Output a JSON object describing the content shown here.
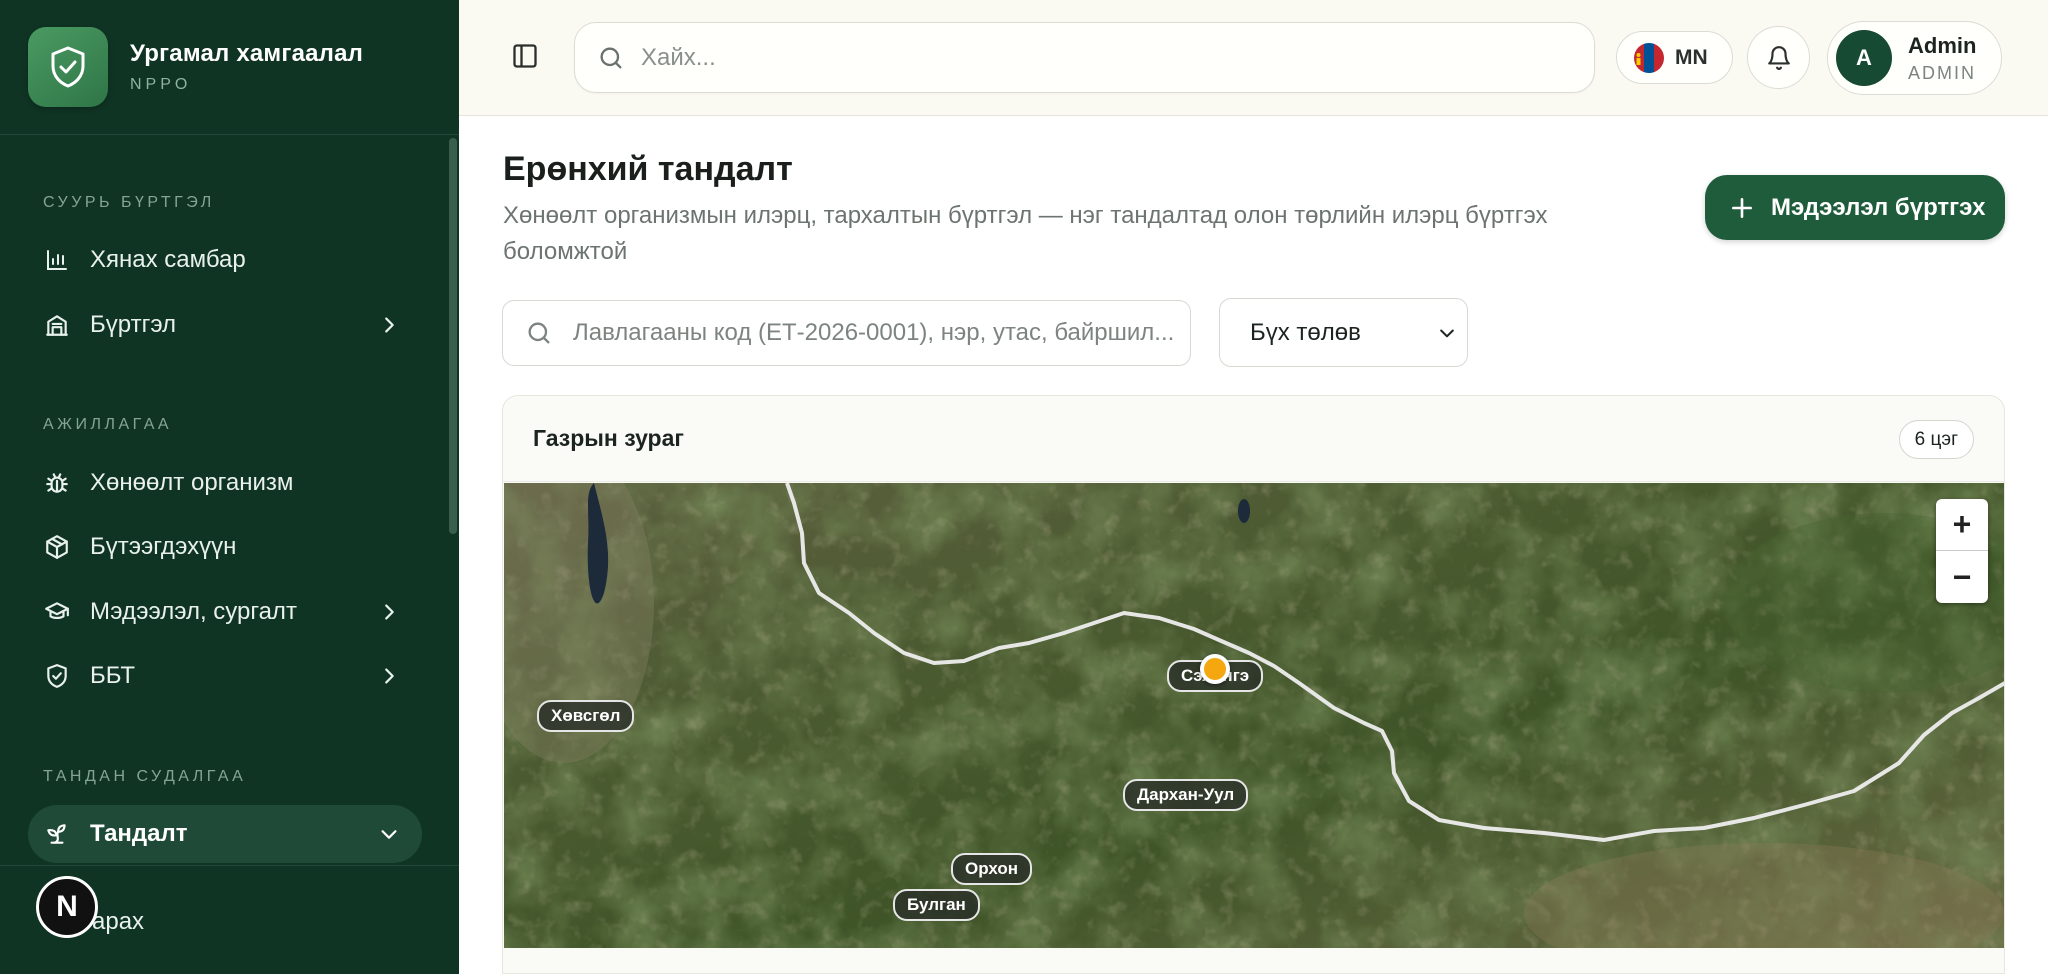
{
  "app": {
    "title": "Ургамал хамгаалал",
    "subtitle": "NPPO"
  },
  "sidebar": {
    "sections": [
      {
        "title": "СУУРЬ БҮРТГЭЛ"
      },
      {
        "title": "АЖИЛЛАГАА"
      },
      {
        "title": "ТАНДАН СУДАЛГАА"
      }
    ],
    "items": [
      {
        "label": "Хянах самбар",
        "icon": "bar-chart-icon"
      },
      {
        "label": "Бүртгэл",
        "icon": "building-icon"
      },
      {
        "label": "Хөнөөлт организм",
        "icon": "bug-icon"
      },
      {
        "label": "Бүтээгдэхүүн",
        "icon": "box-icon"
      },
      {
        "label": "Мэдээлэл, сургалт",
        "icon": "graduation-cap-icon"
      },
      {
        "label": "ББТ",
        "icon": "shield-check-icon"
      },
      {
        "label": "Тандалт",
        "icon": "sprout-icon"
      }
    ],
    "footer_label": "арах",
    "footer_badge": "N"
  },
  "topbar": {
    "search_placeholder": "Хайх...",
    "language": "MN",
    "user": {
      "initial": "A",
      "name": "Admin",
      "role": "ADMIN"
    }
  },
  "main": {
    "title": "Ерөнхий тандалт",
    "description": "Хөнөөлт организмын илэрц, тархалтын бүртгэл — нэг тандалтад олон төрлийн илэрц бүртгэх боломжтой",
    "add_button": "Мэдээлэл бүртгэх",
    "filter_placeholder": "Лавлагааны код (ЕТ-2026-0001), нэр, утас, байршил...",
    "status_filter": "Бүх төлөв",
    "map": {
      "title": "Газрын зураг",
      "count": "6 цэг",
      "zoom_in": "+",
      "zoom_out": "−",
      "places": [
        "Хөвсгөл",
        "Сэлэнгэ",
        "Дархан-Уул",
        "Орхон",
        "Булган"
      ]
    }
  },
  "colors": {
    "sidebar_bg": "#0f3424",
    "accent": "#1e5c3c",
    "marker": "#f5a70f"
  }
}
